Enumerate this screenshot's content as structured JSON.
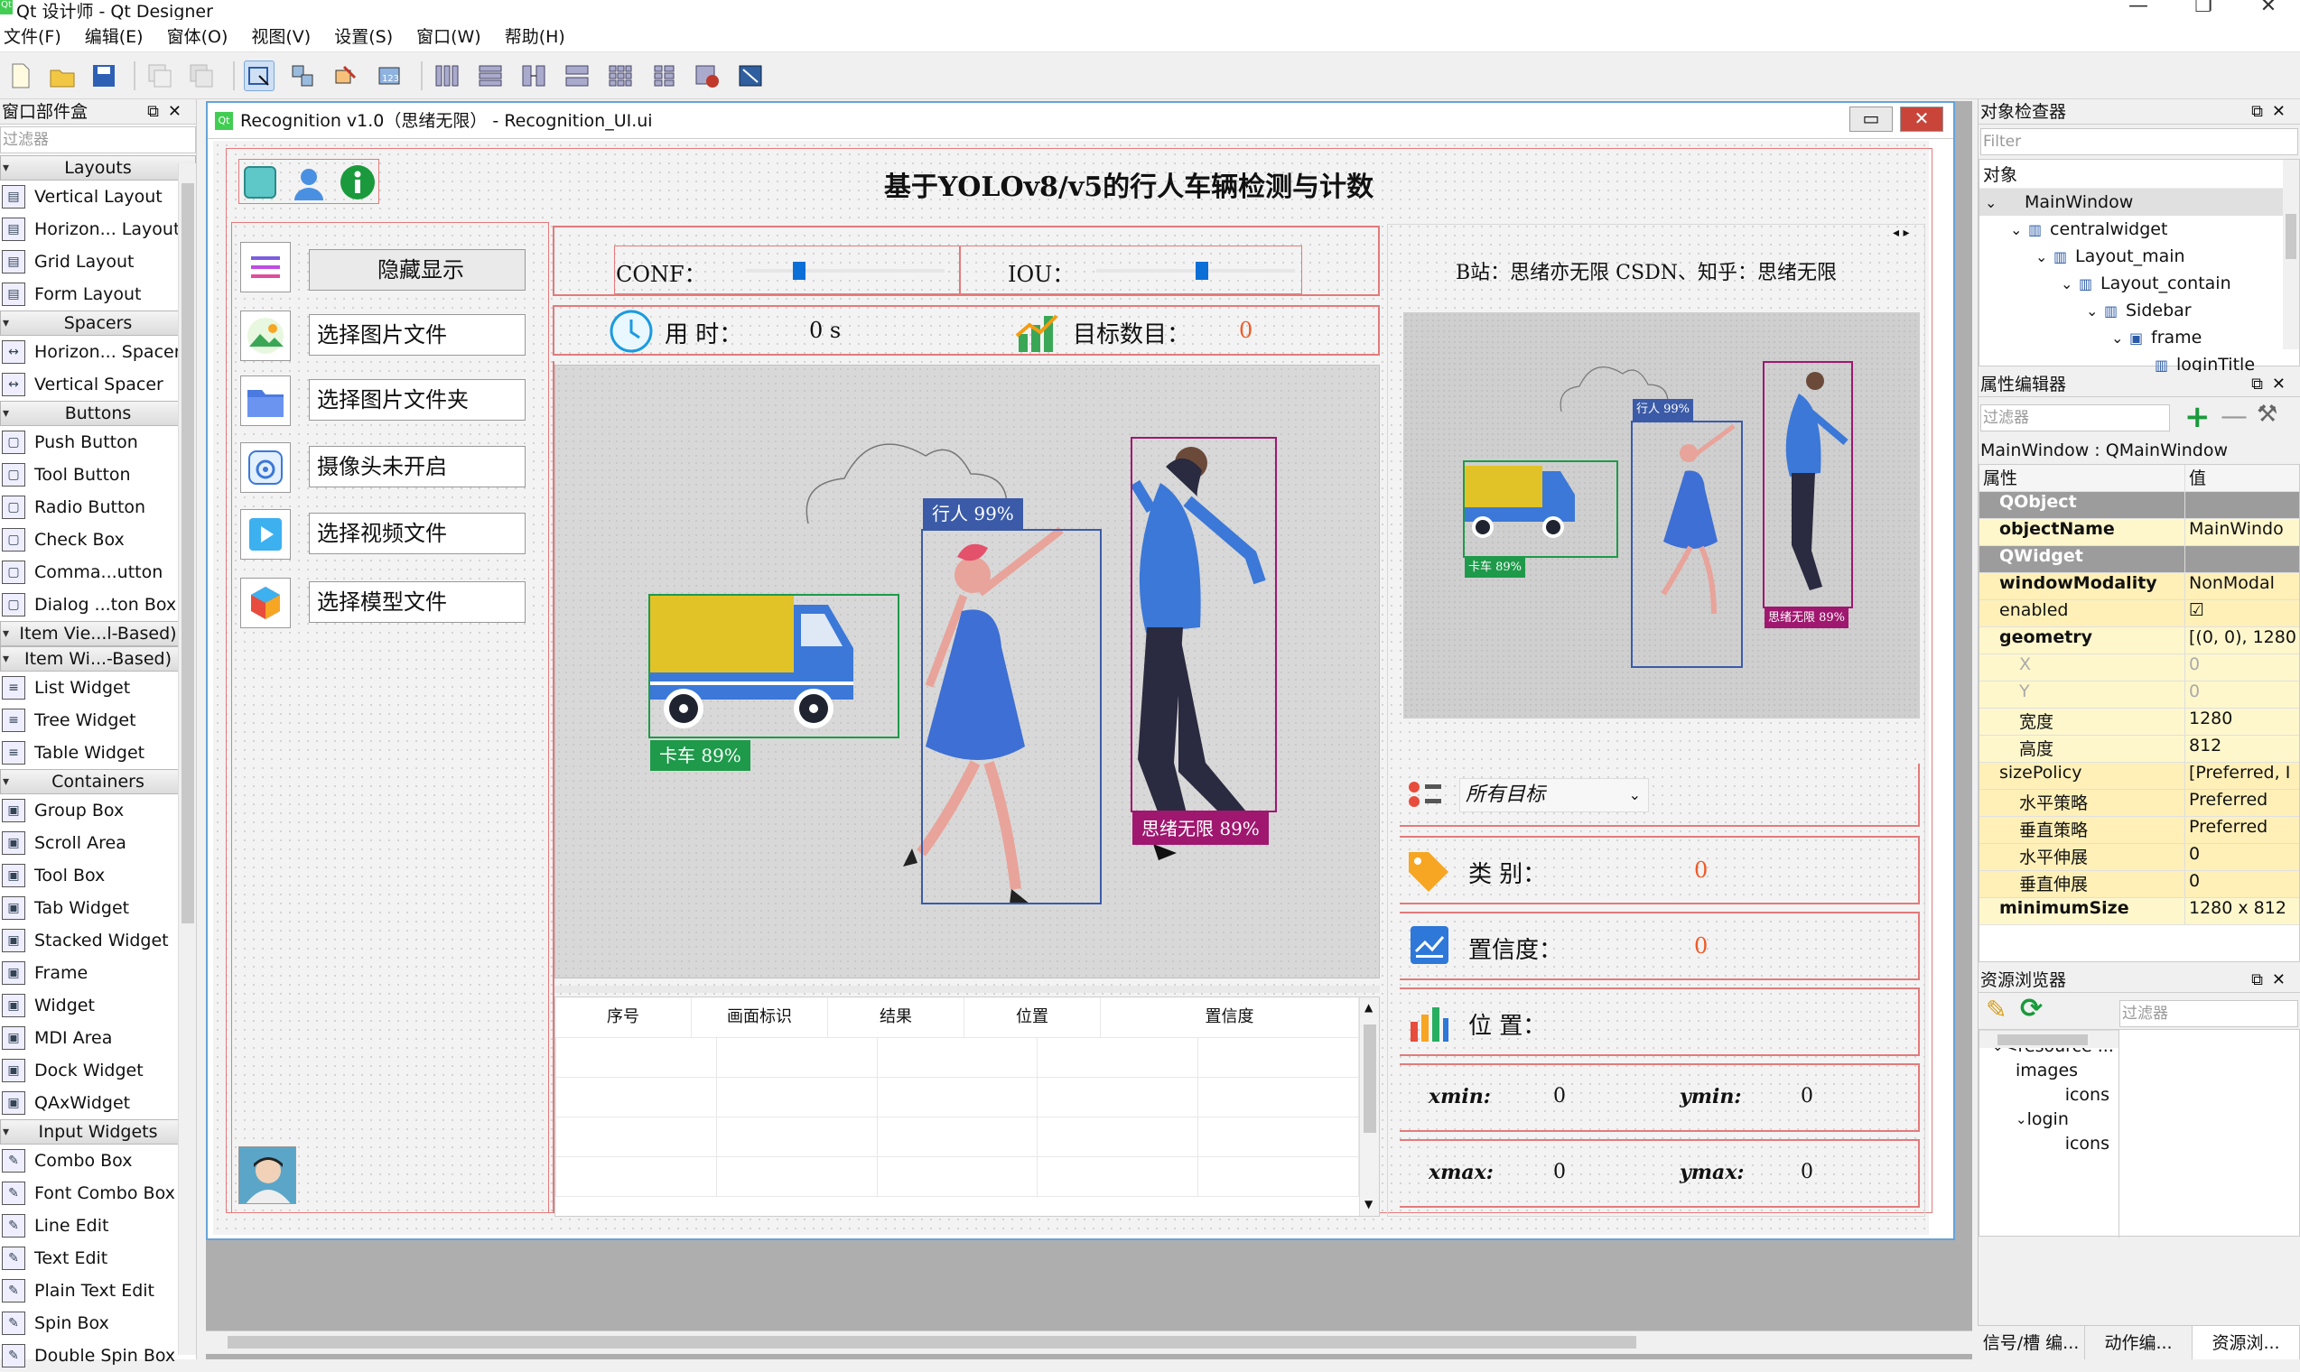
{
  "app": {
    "title": "Qt 设计师 - Qt Designer",
    "logo": "Qt"
  },
  "menu": [
    "文件(F)",
    "编辑(E)",
    "窗体(O)",
    "视图(V)",
    "设置(S)",
    "窗口(W)",
    "帮助(H)"
  ],
  "widget_box": {
    "title": "窗口部件盒",
    "filter_placeholder": "过滤器",
    "groups": [
      {
        "name": "Layouts",
        "items": [
          "Vertical Layout",
          "Horizon... Layout",
          "Grid Layout",
          "Form Layout"
        ]
      },
      {
        "name": "Spacers",
        "items": [
          "Horizon... Spacer",
          "Vertical Spacer"
        ]
      },
      {
        "name": "Buttons",
        "items": [
          "Push Button",
          "Tool Button",
          "Radio Button",
          "Check Box",
          "Comma...utton",
          "Dialog ...ton Box"
        ]
      },
      {
        "name": "Item Vie...l-Based)",
        "items": []
      },
      {
        "name": "Item Wi...-Based)",
        "items": [
          "List Widget",
          "Tree Widget",
          "Table Widget"
        ]
      },
      {
        "name": "Containers",
        "items": [
          "Group Box",
          "Scroll Area",
          "Tool Box",
          "Tab Widget",
          "Stacked Widget",
          "Frame",
          "Widget",
          "MDI Area",
          "Dock Widget",
          "QAxWidget"
        ]
      },
      {
        "name": "Input Widgets",
        "items": [
          "Combo Box",
          "Font Combo Box",
          "Line Edit",
          "Text Edit",
          "Plain Text Edit",
          "Spin Box",
          "Double Spin Box"
        ]
      }
    ]
  },
  "form": {
    "title": "Recognition v1.0（思绪无限） - Recognition_UI.ui",
    "heading": "基于YOLOv8/v5的行人车辆检测与计数",
    "sidebar": [
      {
        "label": "隐藏显示",
        "icon": "menu-icon"
      },
      {
        "label": "选择图片文件",
        "icon": "image-icon"
      },
      {
        "label": "选择图片文件夹",
        "icon": "folder-icon"
      },
      {
        "label": "摄像头未开启",
        "icon": "camera-icon"
      },
      {
        "label": "选择视频文件",
        "icon": "video-icon"
      },
      {
        "label": "选择模型文件",
        "icon": "model-icon"
      }
    ],
    "conf_label": "CONF：",
    "iou_label": "IOU：",
    "time_label": "用 时：",
    "time_value": "0 s",
    "count_label": "目标数目：",
    "count_value": "0",
    "detections": [
      {
        "label": "卡车 89%",
        "color": "#1e9a4a"
      },
      {
        "label": "行人 99%",
        "color": "#3b5ba8"
      },
      {
        "label": "思绪无限 89%",
        "color": "#a0176f"
      }
    ],
    "table_headers": [
      "序号",
      "画面标识",
      "结果",
      "位置",
      "置信度"
    ],
    "credit": "B站：思绪亦无限 CSDN、知乎：思绪无限",
    "preview_labels": [
      "卡车 89%",
      "行人 99%",
      "思绪无限 89%"
    ],
    "target_select": "所有目标",
    "class_label": "类 别：",
    "class_value": "0",
    "confidence_label": "置信度：",
    "confidence_value": "0",
    "position_label": "位 置：",
    "xmin_label": "xmin:",
    "xmin_value": "0",
    "ymin_label": "ymin:",
    "ymin_value": "0",
    "xmax_label": "xmax:",
    "xmax_value": "0",
    "ymax_label": "ymax:",
    "ymax_value": "0"
  },
  "object_inspector": {
    "title": "对象检查器",
    "filter_placeholder": "Filter",
    "column": "对象",
    "tree": [
      {
        "name": "MainWindow",
        "depth": 0
      },
      {
        "name": "centralwidget",
        "depth": 1
      },
      {
        "name": "Layout_main",
        "depth": 2
      },
      {
        "name": "Layout_contain",
        "depth": 3
      },
      {
        "name": "Sidebar",
        "depth": 4
      },
      {
        "name": "frame",
        "depth": 5
      },
      {
        "name": "loginTitle",
        "depth": 6
      }
    ]
  },
  "property_editor": {
    "title": "属性编辑器",
    "filter_placeholder": "过滤器",
    "object": "MainWindow : QMainWindow",
    "col_prop": "属性",
    "col_val": "值",
    "rows": [
      {
        "k": "QObject",
        "v": "",
        "type": "grp"
      },
      {
        "k": "objectName",
        "v": "MainWindo",
        "type": "y",
        "bold": true
      },
      {
        "k": "QWidget",
        "v": "",
        "type": "grp"
      },
      {
        "k": "windowModality",
        "v": "NonModal",
        "type": "y2",
        "bold": true
      },
      {
        "k": "enabled",
        "v": "☑",
        "type": "y2"
      },
      {
        "k": "geometry",
        "v": "[(0, 0), 1280",
        "type": "y",
        "bold": true
      },
      {
        "k": "X",
        "v": "0",
        "type": "y",
        "sub": true,
        "dim": true
      },
      {
        "k": "Y",
        "v": "0",
        "type": "y",
        "sub": true,
        "dim": true
      },
      {
        "k": "宽度",
        "v": "1280",
        "type": "y",
        "sub": true
      },
      {
        "k": "高度",
        "v": "812",
        "type": "y",
        "sub": true
      },
      {
        "k": "sizePolicy",
        "v": "[Preferred, I",
        "type": "y2"
      },
      {
        "k": "水平策略",
        "v": "Preferred",
        "type": "y2",
        "sub": true
      },
      {
        "k": "垂直策略",
        "v": "Preferred",
        "type": "y2",
        "sub": true
      },
      {
        "k": "水平伸展",
        "v": "0",
        "type": "y2",
        "sub": true
      },
      {
        "k": "垂直伸展",
        "v": "0",
        "type": "y2",
        "sub": true
      },
      {
        "k": "minimumSize",
        "v": "1280 x 812",
        "type": "y",
        "bold": true
      }
    ]
  },
  "resource_browser": {
    "title": "资源浏览器",
    "filter_placeholder": "过滤器",
    "tree": [
      "<resource ...",
      "images",
      "icons",
      "login",
      "icons"
    ]
  },
  "bottom_tabs": [
    "信号/槽 编...",
    "动作编...",
    "资源浏..."
  ]
}
